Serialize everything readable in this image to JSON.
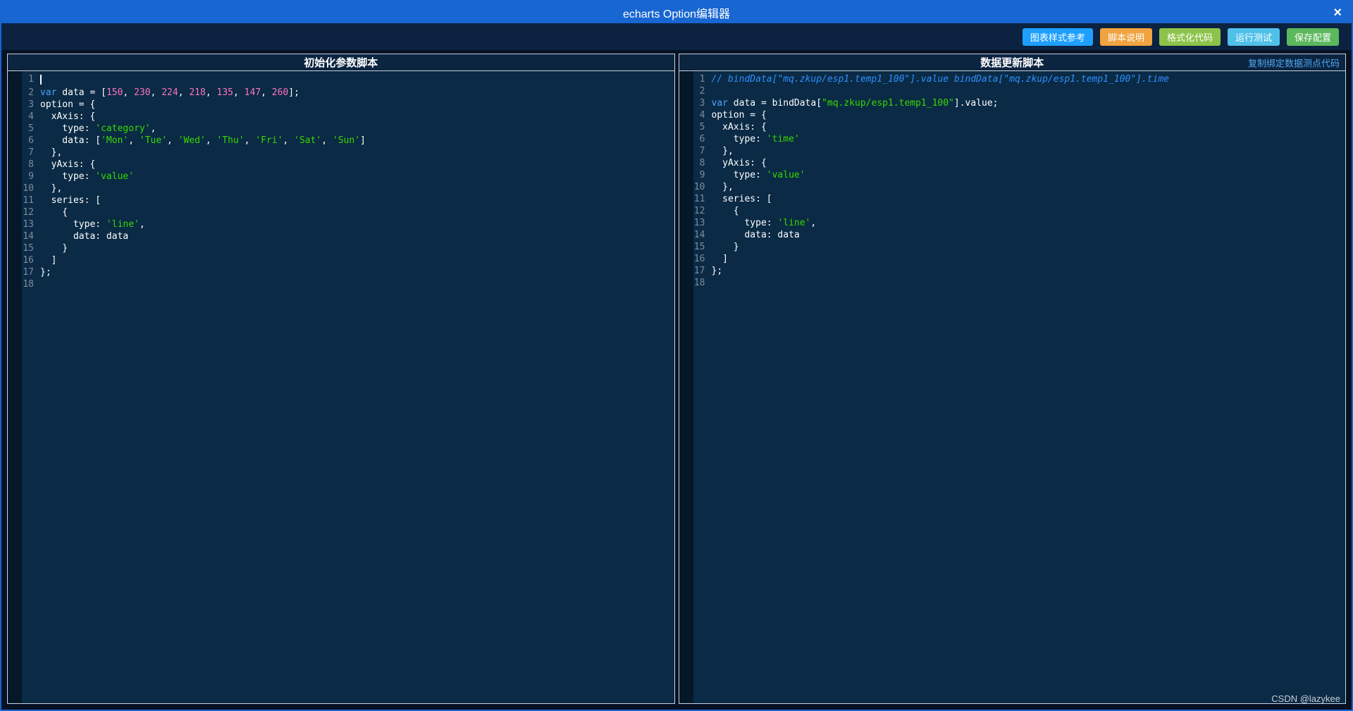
{
  "window": {
    "title": "echarts Option编辑器",
    "close_label": "×"
  },
  "toolbar": {
    "buttons": [
      {
        "name": "chart-style-reference-button",
        "label": "图表样式参考",
        "color": "#1E9FFF"
      },
      {
        "name": "script-help-button",
        "label": "脚本说明",
        "color": "#F0A33F"
      },
      {
        "name": "format-code-button",
        "label": "格式化代码",
        "color": "#8DC34A"
      },
      {
        "name": "run-test-button",
        "label": "运行测试",
        "color": "#4FC1E9"
      },
      {
        "name": "save-config-button",
        "label": "保存配置",
        "color": "#5CB85C"
      }
    ]
  },
  "left_editor": {
    "title": "初始化参数脚本",
    "cursor_line": 1,
    "lines": [
      "",
      "var data = [150, 230, 224, 218, 135, 147, 260];",
      "option = {",
      "  xAxis: {",
      "    type: 'category',",
      "    data: ['Mon', 'Tue', 'Wed', 'Thu', 'Fri', 'Sat', 'Sun']",
      "  },",
      "  yAxis: {",
      "    type: 'value'",
      "  },",
      "  series: [",
      "    {",
      "      type: 'line',",
      "      data: data",
      "    }",
      "  ]",
      "};",
      ""
    ]
  },
  "right_editor": {
    "title": "数据更新脚本",
    "copy_link": "复制绑定数据测点代码",
    "lines": [
      "// bindData[\"mq.zkup/esp1.temp1_100\"].value bindData[\"mq.zkup/esp1.temp1_100\"].time",
      "",
      "var data = bindData[\"mq.zkup/esp1.temp1_100\"].value;",
      "option = {",
      "  xAxis: {",
      "    type: 'time'",
      "  },",
      "  yAxis: {",
      "    type: 'value'",
      "  },",
      "  series: [",
      "    {",
      "      type: 'line',",
      "      data: data",
      "    }",
      "  ]",
      "};",
      ""
    ]
  },
  "watermark": "CSDN @lazykee",
  "colors": {
    "titlebar": "#1766D1",
    "toolbar_bg": "#0B2240",
    "window_bg": "#061224",
    "editor_bg": "#0A2A45",
    "gutter_bg": "#051829",
    "panel_header_bg": "#0B2440",
    "panel_border": "#C8D3DE",
    "line_number": "#7E8C9E",
    "code_plain": "#FFFFFF",
    "syntax_keyword": "#4EA1FF",
    "syntax_number": "#FF74C0",
    "syntax_string": "#3AD900",
    "syntax_comment": "#2F8FFF",
    "link": "#4FA8F0",
    "watermark": "#C9CFD6"
  }
}
